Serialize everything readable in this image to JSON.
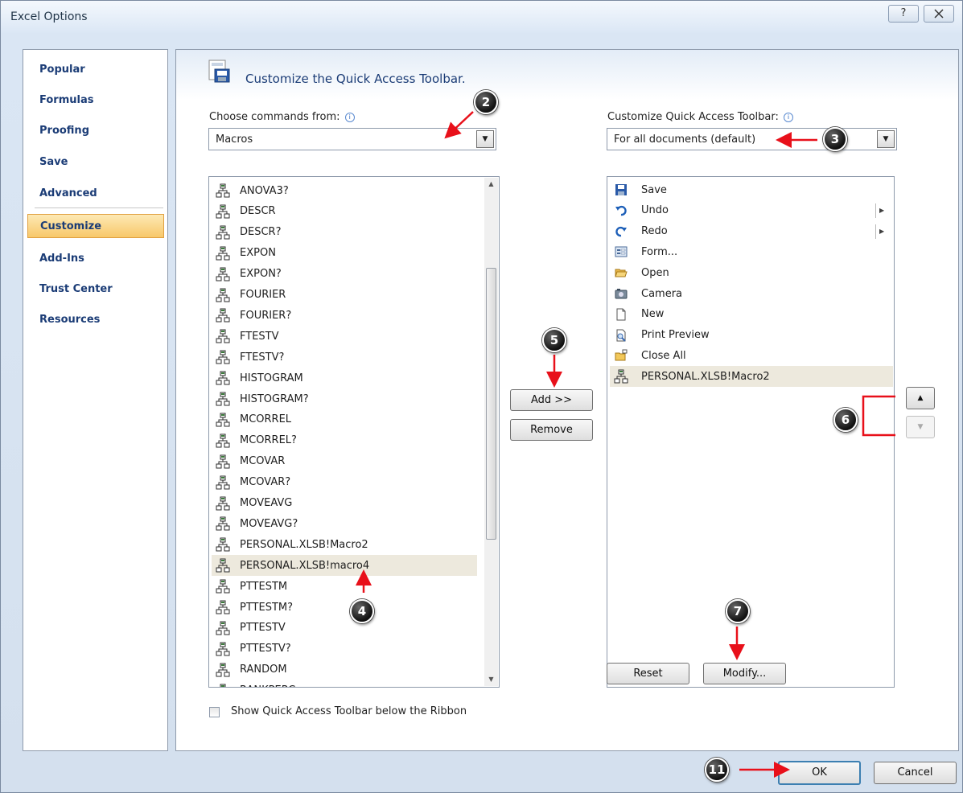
{
  "window": {
    "title": "Excel Options",
    "help_glyph": "?",
    "close_glyph": "☒"
  },
  "nav": {
    "items": [
      {
        "label": "Popular"
      },
      {
        "label": "Formulas"
      },
      {
        "label": "Proofing"
      },
      {
        "label": "Save"
      },
      {
        "label": "Advanced"
      },
      {
        "label": "Customize",
        "selected": true
      },
      {
        "label": "Add-Ins"
      },
      {
        "label": "Trust Center"
      },
      {
        "label": "Resources"
      }
    ]
  },
  "content": {
    "heading": "Customize the Quick Access Toolbar.",
    "choose_label": "Choose commands from:",
    "choose_value": "Macros",
    "customize_label": "Customize Quick Access Toolbar:",
    "customize_value": "For all documents (default)",
    "commands": [
      "ANOVA3?",
      "DESCR",
      "DESCR?",
      "EXPON",
      "EXPON?",
      "FOURIER",
      "FOURIER?",
      "FTESTV",
      "FTESTV?",
      "HISTOGRAM",
      "HISTOGRAM?",
      "MCORREL",
      "MCORREL?",
      "MCOVAR",
      "MCOVAR?",
      "MOVEAVG",
      "MOVEAVG?",
      "PERSONAL.XLSB!Macro2",
      "PERSONAL.XLSB!macro4",
      "PTTESTM",
      "PTTESTM?",
      "PTTESTV",
      "PTTESTV?",
      "RANDOM",
      "RANKPERC"
    ],
    "commands_selected": "PERSONAL.XLSB!macro4",
    "toolbar_items": [
      {
        "label": "Save",
        "icon": "save-icon"
      },
      {
        "label": "Undo",
        "icon": "undo-icon",
        "submenu": true
      },
      {
        "label": "Redo",
        "icon": "redo-icon",
        "submenu": true
      },
      {
        "label": "Form...",
        "icon": "form-icon"
      },
      {
        "label": "Open",
        "icon": "open-folder-icon"
      },
      {
        "label": "Camera",
        "icon": "camera-icon"
      },
      {
        "label": "New",
        "icon": "new-document-icon"
      },
      {
        "label": "Print Preview",
        "icon": "print-preview-icon"
      },
      {
        "label": "Close All",
        "icon": "close-all-icon"
      },
      {
        "label": "PERSONAL.XLSB!Macro2",
        "icon": "macro-icon",
        "selected": true
      }
    ],
    "add_button": "Add >>",
    "remove_button": "Remove",
    "reset_button": "Reset",
    "modify_button": "Modify...",
    "show_below_ribbon": "Show Quick Access Toolbar below the Ribbon",
    "show_below_checked": false
  },
  "footer": {
    "ok_button": "OK",
    "cancel_button": "Cancel"
  },
  "annotations": [
    "2",
    "3",
    "4",
    "5",
    "6",
    "7",
    "11"
  ],
  "colors": {
    "nav_selected": "#f8c86a",
    "nav_text": "#1b3c76",
    "annotation_arrow": "#e8101a",
    "annotation_badge": "#111111"
  }
}
